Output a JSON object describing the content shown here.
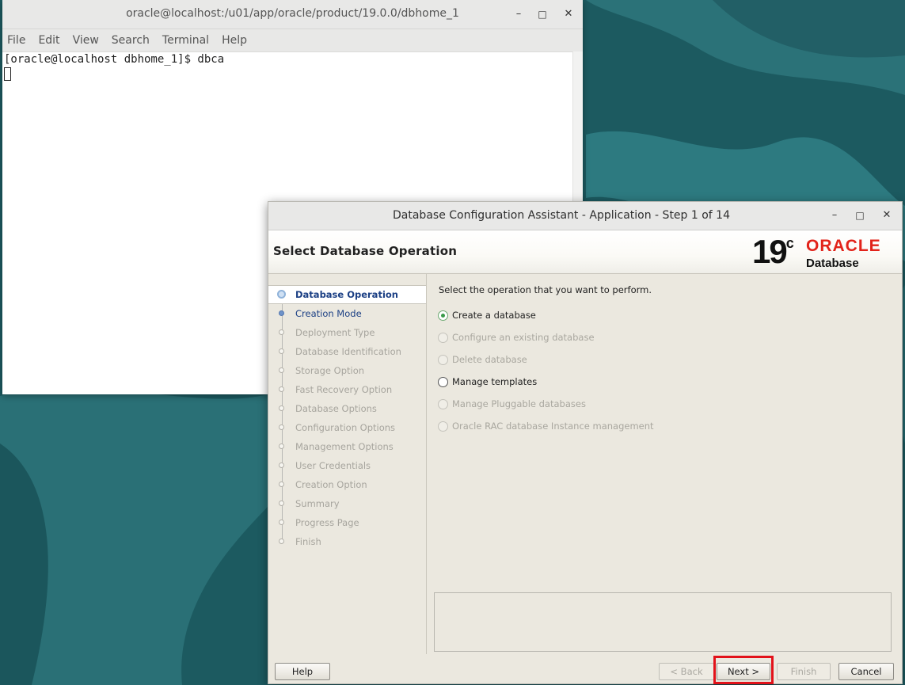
{
  "terminal": {
    "title": "oracle@localhost:/u01/app/oracle/product/19.0.0/dbhome_1",
    "menu": [
      "File",
      "Edit",
      "View",
      "Search",
      "Terminal",
      "Help"
    ],
    "prompt_line": "[oracle@localhost dbhome_1]$ dbca"
  },
  "dbca": {
    "title": "Database Configuration Assistant - Application - Step 1 of 14",
    "page_title": "Select Database Operation",
    "logo": {
      "version": "19",
      "version_suffix": "c",
      "brand": "ORACLE",
      "product": "Database",
      "brand_color": "#e2231a"
    },
    "steps": [
      "Database Operation",
      "Creation Mode",
      "Deployment Type",
      "Database Identification",
      "Storage Option",
      "Fast Recovery Option",
      "Database Options",
      "Configuration Options",
      "Management Options",
      "User Credentials",
      "Creation Option",
      "Summary",
      "Progress Page",
      "Finish"
    ],
    "prompt": "Select the operation that you want to perform.",
    "options": [
      {
        "label": "Create a database",
        "selected": true,
        "enabled": true
      },
      {
        "label": "Configure an existing database",
        "selected": false,
        "enabled": false
      },
      {
        "label": "Delete database",
        "selected": false,
        "enabled": false
      },
      {
        "label": "Manage templates",
        "selected": false,
        "enabled": true
      },
      {
        "label": "Manage Pluggable databases",
        "selected": false,
        "enabled": false
      },
      {
        "label": "Oracle RAC database Instance management",
        "selected": false,
        "enabled": false
      }
    ],
    "buttons": {
      "help": "Help",
      "back": "< Back",
      "next": "Next >",
      "finish": "Finish",
      "cancel": "Cancel"
    },
    "highlight_color": "#e2121a"
  },
  "window_controls": {
    "minimize": "–",
    "maximize": "□",
    "close": "✕"
  }
}
